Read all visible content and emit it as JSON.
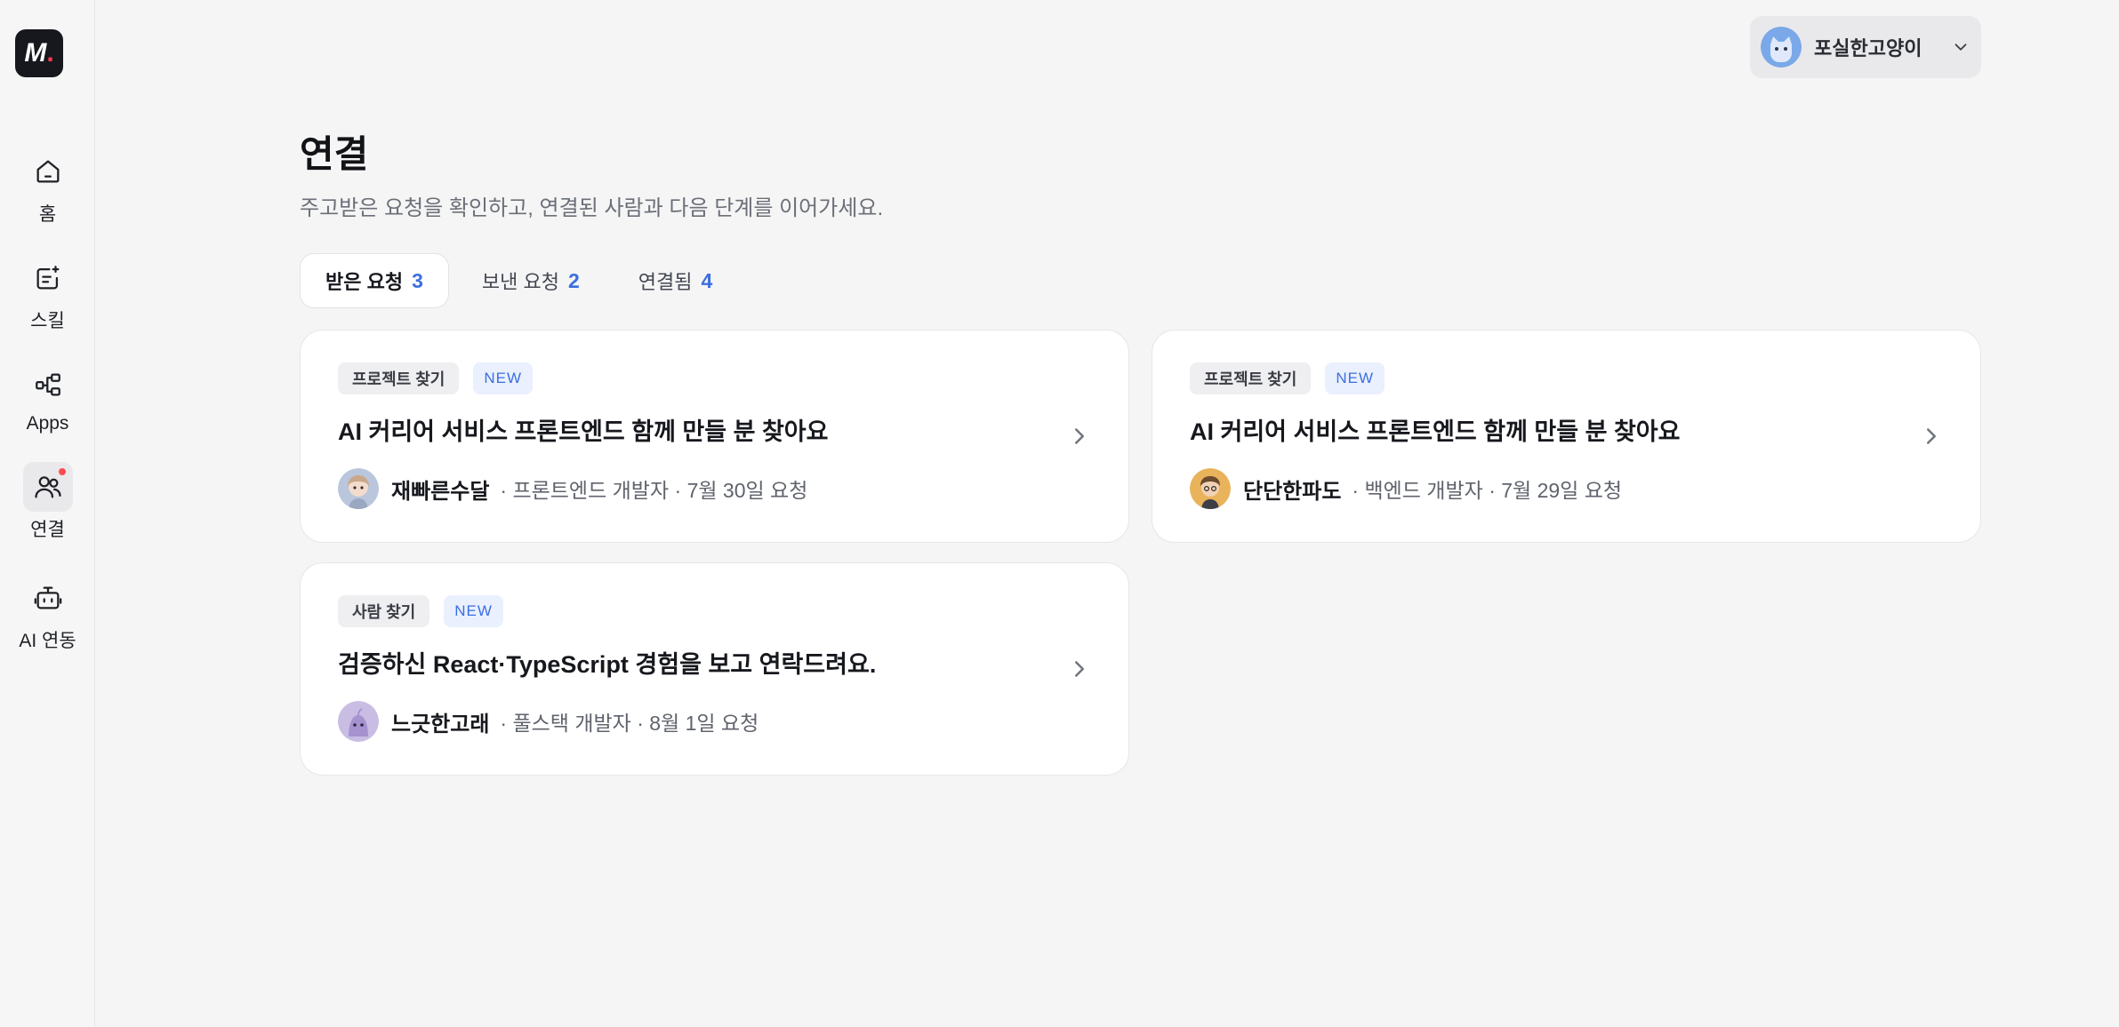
{
  "sidebar": {
    "logo": {
      "letter": "M",
      "dot": "."
    },
    "items": [
      {
        "label": "홈",
        "icon": "home-icon"
      },
      {
        "label": "스킬",
        "icon": "skill-edit-icon"
      },
      {
        "label": "Apps",
        "icon": "apps-flow-icon"
      },
      {
        "label": "연결",
        "icon": "users-icon",
        "active": true,
        "has_notification": true
      },
      {
        "label": "AI 연동",
        "icon": "bot-icon"
      }
    ]
  },
  "header": {
    "profile": {
      "name": "포실한고양이",
      "avatar_icon": "cat-avatar-icon"
    }
  },
  "main": {
    "title": "연결",
    "subtitle": "주고받은 요청을 확인하고, 연결된 사람과 다음 단계를 이어가세요.",
    "tabs": [
      {
        "label": "받은 요청",
        "count": "3",
        "active": true
      },
      {
        "label": "보낸 요청",
        "count": "2"
      },
      {
        "label": "연결됨",
        "count": "4"
      }
    ],
    "cards": [
      {
        "category": "프로젝트 찾기",
        "badge": "NEW",
        "title": "AI 커리어 서비스 프론트엔드 함께 만들 분 찾아요",
        "user": "재빠른수달",
        "info": "· 프론트엔드 개발자 · 7월 30일 요청"
      },
      {
        "category": "프로젝트 찾기",
        "badge": "NEW",
        "title": "AI 커리어 서비스 프론트엔드 함께 만들 분 찾아요",
        "user": "단단한파도",
        "info": "· 백엔드 개발자 · 7월 29일 요청"
      },
      {
        "category": "사람 찾기",
        "badge": "NEW",
        "title": "검증하신 React·TypeScript 경험을 보고 연락드려요.",
        "user": "느긋한고래",
        "info": "· 풀스택 개발자 · 8월 1일 요청"
      }
    ]
  },
  "colors": {
    "accent": "#3b6fe0",
    "notification": "#ff4d4f",
    "logo_bg": "#16181d"
  }
}
